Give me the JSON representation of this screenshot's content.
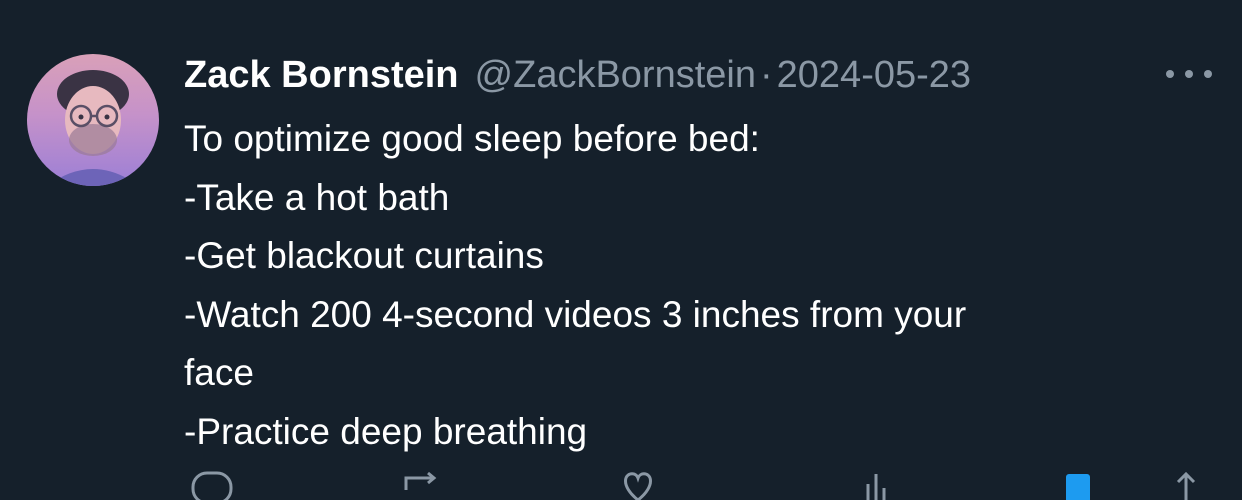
{
  "tweet": {
    "display_name": "Zack Bornstein",
    "handle": "@ZackBornstein",
    "separator": "·",
    "date": "2024-05-23",
    "lines": [
      "To optimize good sleep before bed:",
      "-Take a hot bath",
      "-Get blackout curtains",
      "-Watch 200 4-second videos 3 inches from your",
      "face",
      "-Practice deep breathing"
    ]
  },
  "icons": {
    "more": "more-options-icon",
    "reply": "reply-icon",
    "retweet": "retweet-icon",
    "like": "like-icon",
    "views": "views-icon",
    "bookmark": "bookmark-icon",
    "share": "share-icon"
  },
  "colors": {
    "background": "#15202b",
    "secondary_text": "#8b98a5",
    "primary_text": "#ffffff",
    "accent": "#1d9bf0"
  }
}
